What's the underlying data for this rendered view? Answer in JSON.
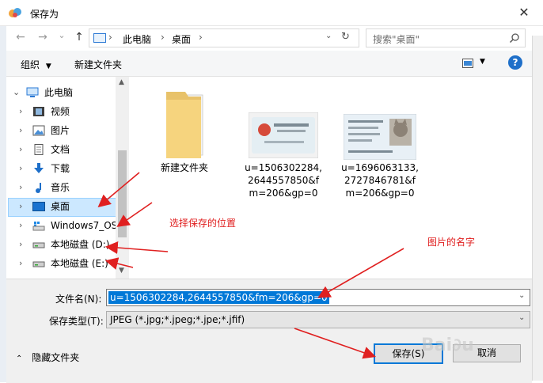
{
  "window": {
    "title": "保存为",
    "close_glyph": "✕"
  },
  "nav": {
    "back": "←",
    "forward": "→",
    "dropdown": "⌄",
    "up": "↑",
    "breadcrumb": [
      "此电脑",
      "桌面"
    ],
    "search_placeholder": "搜索\"桌面\""
  },
  "toolbar": {
    "organize": "组织",
    "new_folder": "新建文件夹",
    "help": "?"
  },
  "sidebar": {
    "items": [
      {
        "label": "此电脑",
        "icon": "computer-icon"
      },
      {
        "label": "视频",
        "icon": "video-icon"
      },
      {
        "label": "图片",
        "icon": "pictures-icon"
      },
      {
        "label": "文档",
        "icon": "documents-icon"
      },
      {
        "label": "下载",
        "icon": "download-icon"
      },
      {
        "label": "音乐",
        "icon": "music-icon"
      },
      {
        "label": "桌面",
        "icon": "desktop-icon"
      },
      {
        "label": "Windows7_OS",
        "icon": "windows-drive-icon"
      },
      {
        "label": "本地磁盘 (D:)",
        "icon": "drive-icon"
      },
      {
        "label": "本地磁盘 (E:)",
        "icon": "drive-icon"
      }
    ]
  },
  "files": [
    {
      "name": "新建文件夹",
      "type": "folder"
    },
    {
      "name_lines": [
        "u=1506302284,",
        "2644557850&f",
        "m=206&gp=0"
      ],
      "type": "image"
    },
    {
      "name_lines": [
        "u=1696063133,",
        "2727846781&f",
        "m=206&gp=0"
      ],
      "type": "image"
    }
  ],
  "form": {
    "filename_label": "文件名(N):",
    "filename_value": "u=1506302284,2644557850&fm=206&gp=0",
    "filetype_label": "保存类型(T):",
    "filetype_value": "JPEG (*.jpg;*.jpeg;*.jpe;*.jfif)"
  },
  "footer": {
    "hide_folders": "隐藏文件夹",
    "save": "保存(S)",
    "cancel": "取消"
  },
  "annotations": {
    "location_note": "选择保存的位置",
    "name_note": "图片的名字"
  },
  "colors": {
    "accent": "#0078d7",
    "annotation": "#e02020",
    "selection": "#cce8ff"
  }
}
